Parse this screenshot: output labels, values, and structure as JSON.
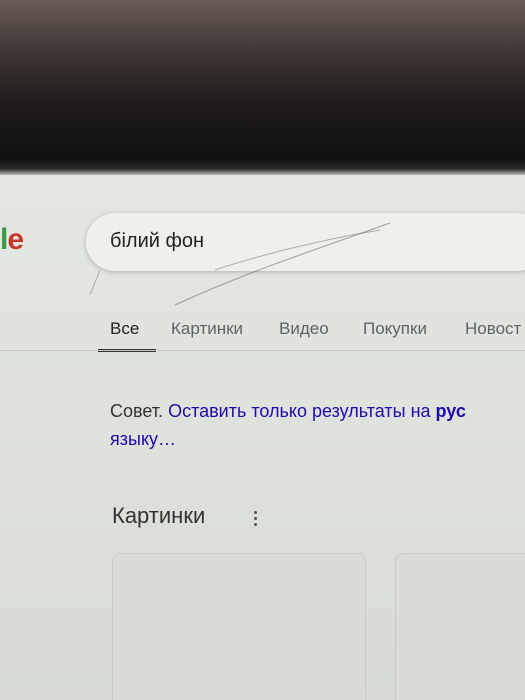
{
  "logo": {
    "visible_letters_a": "l",
    "visible_letters_b": "e"
  },
  "search": {
    "query": "білий фон"
  },
  "tabs": [
    {
      "label": "Все",
      "active": true
    },
    {
      "label": "Картинки",
      "active": false
    },
    {
      "label": "Видео",
      "active": false
    },
    {
      "label": "Покупки",
      "active": false
    },
    {
      "label": "Новост",
      "active": false
    }
  ],
  "tip": {
    "prefix": "Совет.",
    "link_text": "Оставить только результаты на",
    "bold_text": "рус",
    "line2": "языку…"
  },
  "images_section": {
    "title": "Картинки"
  },
  "colors": {
    "link": "#1a0dab",
    "logo_green": "#3a9a48",
    "logo_red": "#c8372d"
  },
  "icons": {
    "more": "more-vert-icon"
  }
}
